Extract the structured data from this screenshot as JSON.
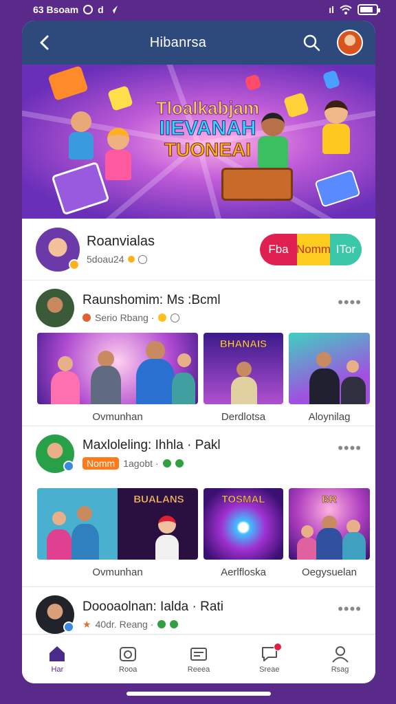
{
  "status_bar": {
    "left_text": "63 Bsoam",
    "signal_text": "ıl"
  },
  "header": {
    "title": "Hibanrsa"
  },
  "hero": {
    "line1": "Tloalkabjam",
    "line2": "IIEVANAH",
    "line3": "TUONEAI"
  },
  "profile": {
    "name": "Roanvialas",
    "sub": "5doau24",
    "pill": [
      "Fba",
      "Nomm",
      "ITor"
    ]
  },
  "posts": [
    {
      "name": "Raunshomim: Ms :Bcml",
      "sub": "Serio Rbang ·",
      "more": "••••",
      "thumbs": [
        {
          "caption": "Ovmunhan",
          "overlay": ""
        },
        {
          "caption": "Derdlotsa",
          "overlay": "BHANAIS"
        },
        {
          "caption": "Aloynilag",
          "overlay": ""
        }
      ]
    },
    {
      "name": "Maxloleling: Ihhla · Pakl",
      "tag": "Nomm",
      "sub": "1agobt ·",
      "more": "••••",
      "thumbs": [
        {
          "caption": "Ovmunhan",
          "overlay": "BUALANS"
        },
        {
          "caption": "Aerlfloska",
          "overlay": "TOSMAL"
        },
        {
          "caption": "Oegysuelan",
          "overlay": "BR"
        }
      ]
    },
    {
      "name": "Doooaolnan: Ialda · Rati",
      "sub": "40dr. Reang ·",
      "more": "••••"
    }
  ],
  "tabbar": [
    {
      "label": "Har",
      "icon": "home-icon"
    },
    {
      "label": "Rooa",
      "icon": "camera-icon"
    },
    {
      "label": "Reeea",
      "icon": "cards-icon"
    },
    {
      "label": "Sreae",
      "icon": "chat-icon"
    },
    {
      "label": "Rsag",
      "icon": "profile-icon"
    }
  ],
  "colors": {
    "header": "#2e4a7c",
    "background": "#5a2a8a",
    "accent": "#e02050"
  }
}
